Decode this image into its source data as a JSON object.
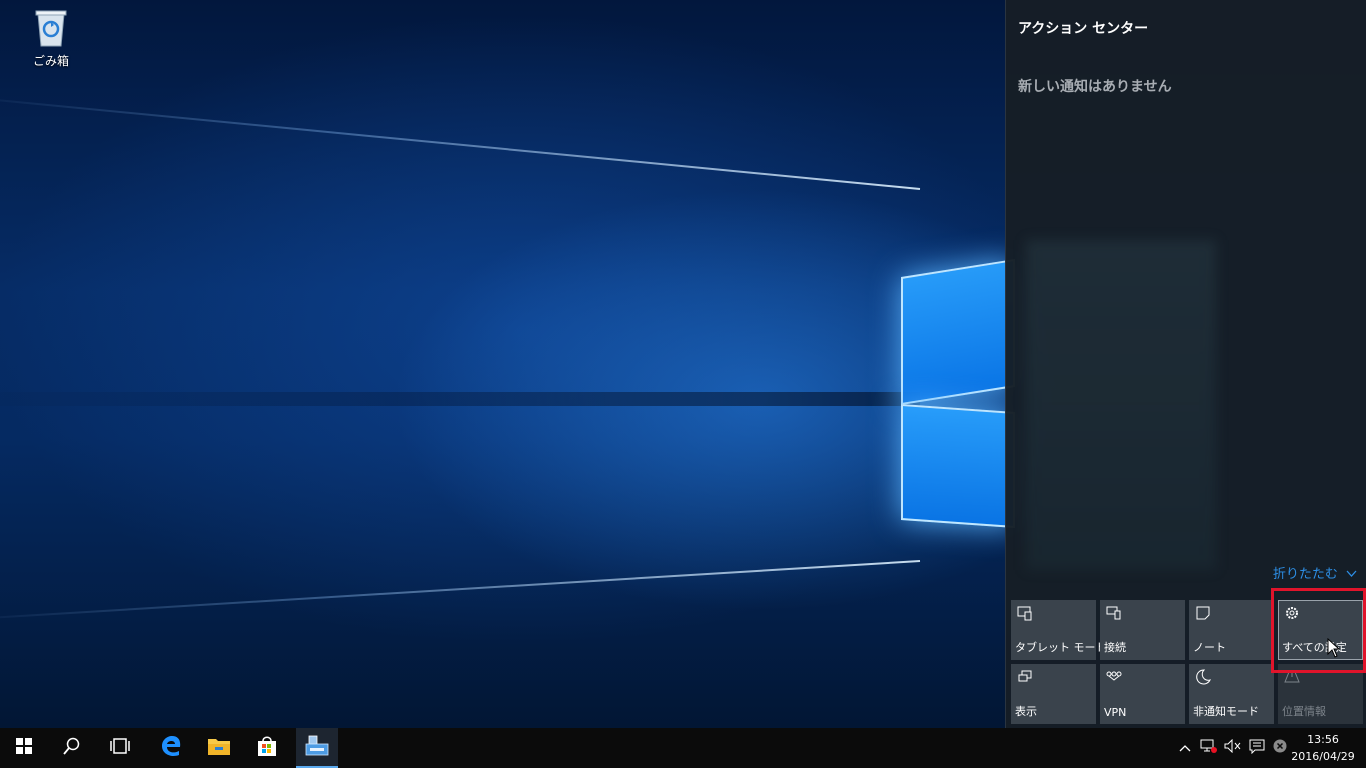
{
  "desktop": {
    "icons": [
      {
        "label": "ごみ箱",
        "icon": "recycle-bin-icon"
      }
    ]
  },
  "action_center": {
    "title": "アクション センター",
    "empty_message": "新しい通知はありません",
    "collapse_label": "折りたたむ",
    "accent_color": "#2d8fe6",
    "quick_actions": [
      {
        "label": "タブレット モード",
        "icon": "tablet-mode-icon",
        "enabled": true
      },
      {
        "label": "接続",
        "icon": "connect-icon",
        "enabled": true
      },
      {
        "label": "ノート",
        "icon": "note-icon",
        "enabled": true
      },
      {
        "label": "すべての設定",
        "icon": "gear-icon",
        "enabled": true
      },
      {
        "label": "表示",
        "icon": "project-icon",
        "enabled": true
      },
      {
        "label": "VPN",
        "icon": "vpn-icon",
        "enabled": true
      },
      {
        "label": "非通知モード",
        "icon": "moon-icon",
        "enabled": true
      },
      {
        "label": "位置情報",
        "icon": "location-icon",
        "enabled": false
      }
    ]
  },
  "taskbar": {
    "pinned": [
      "start-icon",
      "search-icon",
      "task-view-icon",
      "edge-icon",
      "file-explorer-icon",
      "store-icon",
      "app-icon"
    ],
    "tray": [
      "chevron-up-icon",
      "network-icon",
      "volume-muted-icon",
      "action-center-icon",
      "close-circle-icon"
    ],
    "time": "13:56",
    "date": "2016/04/29"
  }
}
